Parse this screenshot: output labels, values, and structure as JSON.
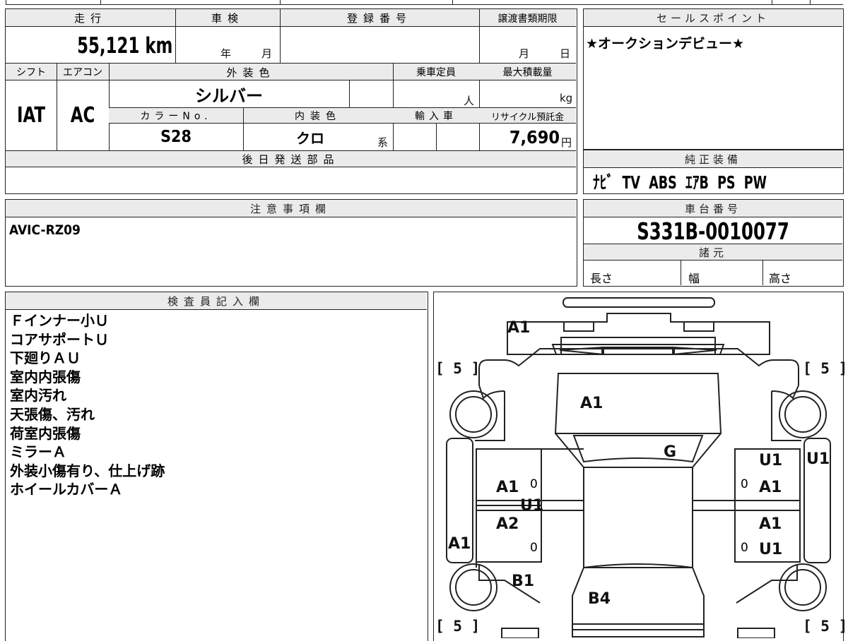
{
  "vehicle_info": {
    "mileage": {
      "label": "走行",
      "value": "55,121 km"
    },
    "shaken": {
      "label": "車検",
      "year_unit": "年",
      "month_unit": "月"
    },
    "registration_no": {
      "label": "登録番号",
      "value": ""
    },
    "transfer_deadline": {
      "label": "譲渡書類期限",
      "month_unit": "月",
      "day_unit": "日"
    },
    "shift": {
      "label": "シフト",
      "value": "IAT"
    },
    "aircon": {
      "label": "エアコン",
      "value": "AC"
    },
    "exterior_color": {
      "label": "外装色",
      "value": "シルバー"
    },
    "capacity": {
      "label": "乗車定員",
      "unit": "人"
    },
    "max_load": {
      "label": "最大積載量",
      "unit": "kg"
    },
    "color_no": {
      "label": "カラーNo.",
      "value": "S28"
    },
    "interior_color": {
      "label": "内装色",
      "value": "クロ",
      "suffix": "系"
    },
    "imported": {
      "label": "輸入車"
    },
    "recycle_fee": {
      "label": "リサイクル預託金",
      "value": "7,690",
      "unit": "円"
    },
    "later_parts": {
      "label": "後日発送部品",
      "value": ""
    }
  },
  "sales_point": {
    "label": "セールスポイント",
    "value": "★オークションデビュー★"
  },
  "equipment": {
    "label": "純正装備",
    "value": "ﾅﾋﾞ  TV  ABS  ｴｱB  PS  PW"
  },
  "notice": {
    "label": "注意事項欄",
    "value": "AVIC-RZ09"
  },
  "chassis": {
    "label": "車台番号",
    "value": "S331B-0010077"
  },
  "specs": {
    "label": "諸元",
    "length": "長さ",
    "width": "幅",
    "height": "高さ"
  },
  "inspector": {
    "label": "検査員記入欄",
    "notes": [
      "Ｆインナー小Ｕ",
      "コアサポートＵ",
      "下廻りＡＵ",
      "室内内張傷",
      "室内汚れ",
      "天張傷、汚れ",
      "荷室内張傷",
      "ミラーＡ",
      "外装小傷有り、仕上げ跡",
      "ホイールカバーＡ"
    ]
  },
  "diagram": {
    "marks": {
      "front_bumper": "A1",
      "hood": "A1",
      "windshield": "G",
      "left_front_fender": "A1",
      "left_front_door": "A1",
      "left_door_lower": "U1",
      "left_rear_door": "A2",
      "left_quarter": "A1",
      "left_rear": "B1",
      "rear_gate": "B4",
      "right_front_fender": "U1",
      "right_front_door": "A1",
      "right_rear_door": "A1",
      "right_rear_door_lower": "U1",
      "right_side": "U1"
    },
    "tire_depth": {
      "front_left": "[ 5 ]",
      "front_right": "[ 5 ]",
      "rear_left": "[ 5 ]",
      "rear_right": "[ 5 ]"
    },
    "zero_marks": [
      "0",
      "0",
      "0",
      "0"
    ]
  }
}
